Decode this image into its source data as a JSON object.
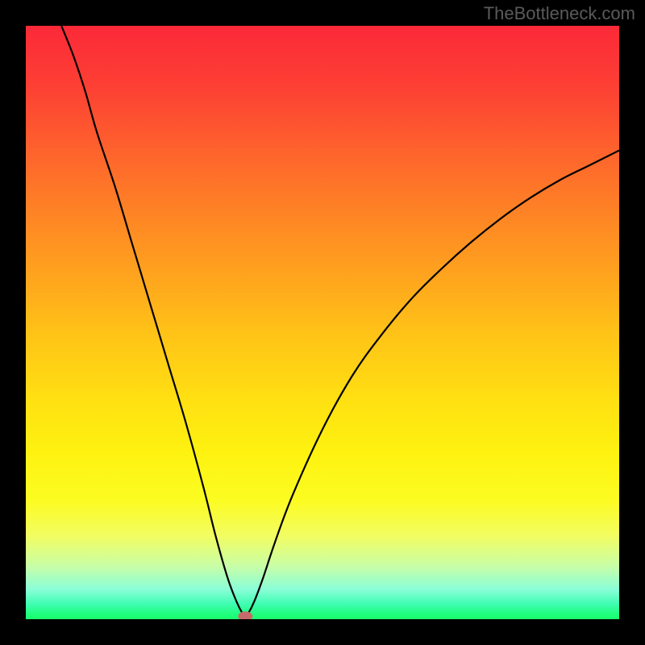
{
  "watermark": "TheBottleneck.com",
  "chart_data": {
    "type": "line",
    "title": "",
    "xlabel": "",
    "ylabel": "",
    "xlim": [
      0,
      100
    ],
    "ylim": [
      0,
      100
    ],
    "grid": false,
    "legend": false,
    "series": [
      {
        "name": "bottleneck-curve",
        "x": [
          6,
          8,
          10,
          12,
          15,
          18,
          21,
          24,
          27,
          30,
          32,
          34,
          35.5,
          36.5,
          37,
          37.5,
          38.5,
          40,
          42,
          45,
          50,
          55,
          60,
          65,
          70,
          75,
          80,
          85,
          90,
          95,
          100
        ],
        "values": [
          100,
          95,
          89,
          82,
          73,
          63,
          53,
          43,
          33,
          22,
          14,
          7,
          3,
          1,
          0.5,
          1,
          3,
          7,
          13,
          21,
          32,
          41,
          48,
          54,
          59,
          63.5,
          67.5,
          71,
          74,
          76.5,
          79
        ]
      }
    ],
    "marker": {
      "x": 37,
      "y": 0.5,
      "shape": "pill",
      "color": "#c66a6a"
    },
    "background": {
      "type": "vertical-gradient",
      "stops": [
        {
          "pct": 0,
          "color": "#fc2938"
        },
        {
          "pct": 25,
          "color": "#fe6f2a"
        },
        {
          "pct": 52,
          "color": "#ffc317"
        },
        {
          "pct": 80,
          "color": "#fcfc22"
        },
        {
          "pct": 95,
          "color": "#89fed8"
        },
        {
          "pct": 100,
          "color": "#18fe6c"
        }
      ]
    }
  }
}
